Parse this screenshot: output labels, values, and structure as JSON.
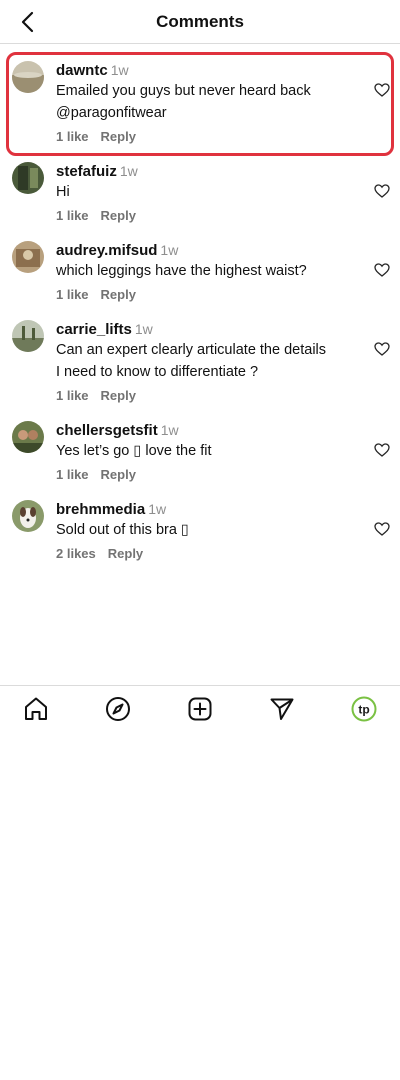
{
  "header": {
    "title": "Comments"
  },
  "comments": [
    {
      "user": "dawntc",
      "time": "1w",
      "text": "Emailed you guys but never heard back @paragonfitwear",
      "likes": "1 like",
      "reply": "Reply"
    },
    {
      "user": "stefafuiz",
      "time": "1w",
      "text": "Hi",
      "likes": "1 like",
      "reply": "Reply"
    },
    {
      "user": "audrey.mifsud",
      "time": "1w",
      "text": "which leggings have the highest waist?",
      "likes": "1 like",
      "reply": "Reply"
    },
    {
      "user": "carrie_lifts",
      "time": "1w",
      "text": "Can an expert clearly articulate the details I need to know to differentiate ?",
      "likes": "1 like",
      "reply": "Reply"
    },
    {
      "user": "chellersgetsfit",
      "time": "1w",
      "text": "Yes let’s go ▯ love the fit",
      "likes": "1 like",
      "reply": "Reply"
    },
    {
      "user": "brehmmedia",
      "time": "1w",
      "text": "Sold out of this bra ▯",
      "likes": "2 likes",
      "reply": "Reply"
    }
  ],
  "tabbar": {
    "items": [
      "home-icon",
      "explore-icon",
      "create-icon",
      "direct-icon",
      "profile-icon"
    ],
    "profile_initials": "tp",
    "profile_color": "#7ac143"
  },
  "colors": {
    "highlight": "#e0323e",
    "meta": "#737373"
  }
}
